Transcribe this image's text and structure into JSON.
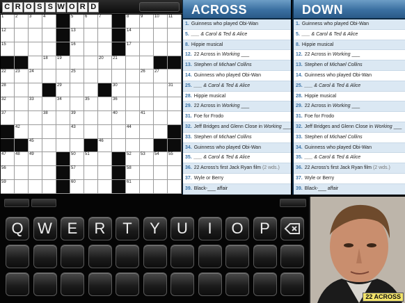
{
  "header": {
    "logo_letters": [
      "C",
      "R",
      "O",
      "S",
      "S",
      "W",
      "O",
      "R",
      "D"
    ]
  },
  "grid": {
    "rows": [
      [
        {
          "n": "1"
        },
        {
          "n": "2"
        },
        {
          "n": "3"
        },
        {
          "n": "4"
        },
        {
          "b": 1
        },
        {
          "n": "5"
        },
        {
          "n": "6"
        },
        {
          "n": "7"
        },
        {
          "b": 1
        },
        {
          "n": "8"
        },
        {
          "n": "9"
        },
        {
          "n": "10"
        },
        {
          "n": "11"
        }
      ],
      [
        {
          "n": "12"
        },
        {},
        {},
        {},
        {
          "b": 1
        },
        {
          "n": "13"
        },
        {},
        {},
        {
          "b": 1
        },
        {
          "n": "14"
        },
        {},
        {},
        {}
      ],
      [
        {
          "n": "15"
        },
        {},
        {},
        {},
        {
          "b": 1
        },
        {
          "n": "16"
        },
        {},
        {},
        {
          "b": 1
        },
        {
          "n": "17"
        },
        {},
        {},
        {}
      ],
      [
        {
          "b": 1
        },
        {
          "b": 1
        },
        {},
        {
          "n": "18"
        },
        {
          "n": "19"
        },
        {},
        {},
        {
          "n": "20"
        },
        {
          "n": "21"
        },
        {},
        {},
        {
          "b": 1
        },
        {
          "b": 1
        }
      ],
      [
        {
          "n": "22"
        },
        {
          "n": "23"
        },
        {
          "n": "24"
        },
        {},
        {},
        {
          "n": "25"
        },
        {},
        {},
        {},
        {},
        {
          "n": "26"
        },
        {
          "n": "27"
        },
        {}
      ],
      [
        {
          "n": "28"
        },
        {},
        {},
        {
          "b": 1
        },
        {
          "n": "29"
        },
        {},
        {},
        {
          "b": 1
        },
        {
          "n": "30"
        },
        {},
        {},
        {},
        {
          "n": "31"
        }
      ],
      [
        {
          "n": "32"
        },
        {},
        {
          "n": "33"
        },
        {},
        {
          "n": "34"
        },
        {},
        {
          "n": "35"
        },
        {},
        {
          "n": "36"
        },
        {},
        {},
        {},
        {}
      ],
      [
        {
          "n": "37"
        },
        {},
        {},
        {
          "n": "38"
        },
        {},
        {
          "n": "39"
        },
        {},
        {},
        {
          "n": "40"
        },
        {},
        {
          "n": "41"
        },
        {},
        {}
      ],
      [
        {
          "b": 1
        },
        {
          "n": "42"
        },
        {},
        {},
        {},
        {
          "n": "43"
        },
        {},
        {},
        {},
        {
          "n": "44"
        },
        {},
        {},
        {
          "b": 1
        }
      ],
      [
        {
          "b": 1
        },
        {
          "b": 1
        },
        {
          "n": "45"
        },
        {},
        {},
        {},
        {
          "b": 1
        },
        {
          "n": "46"
        },
        {},
        {},
        {},
        {
          "b": 1
        },
        {
          "b": 1
        }
      ],
      [
        {
          "n": "47"
        },
        {
          "n": "48"
        },
        {
          "n": "49"
        },
        {},
        {
          "b": 1
        },
        {
          "n": "50"
        },
        {
          "n": "51"
        },
        {},
        {
          "b": 1
        },
        {
          "n": "52"
        },
        {
          "n": "53"
        },
        {
          "n": "54"
        },
        {
          "n": "55"
        }
      ],
      [
        {
          "n": "56"
        },
        {},
        {},
        {},
        {
          "b": 1
        },
        {
          "n": "57"
        },
        {},
        {},
        {
          "b": 1
        },
        {
          "n": "58"
        },
        {},
        {},
        {}
      ],
      [
        {
          "n": "59"
        },
        {},
        {},
        {},
        {
          "b": 1
        },
        {
          "n": "60"
        },
        {},
        {},
        {
          "b": 1
        },
        {
          "n": "61"
        },
        {},
        {},
        {}
      ]
    ]
  },
  "across": {
    "title": "ACROSS",
    "clues": [
      {
        "num": "1.",
        "parts": [
          {
            "t": "Guinness who played Obi-Wan"
          }
        ]
      },
      {
        "num": "5.",
        "parts": [
          {
            "t": "___ & Carol & Ted & Alice",
            "i": 1
          }
        ]
      },
      {
        "num": "8.",
        "parts": [
          {
            "t": "Hippie musical"
          }
        ]
      },
      {
        "num": "12.",
        "parts": [
          {
            "t": "22 Across in "
          },
          {
            "t": "Working",
            "i": 1
          },
          {
            "t": " ___"
          }
        ]
      },
      {
        "num": "13.",
        "parts": [
          {
            "t": "Stephen of "
          },
          {
            "t": "Michael Collins",
            "i": 1
          }
        ]
      },
      {
        "num": "14.",
        "parts": [
          {
            "t": "Guinness who played Obi-Wan"
          }
        ]
      },
      {
        "num": "25.",
        "parts": [
          {
            "t": "___ & Carol & Ted & Alice",
            "i": 1
          }
        ]
      },
      {
        "num": "28.",
        "parts": [
          {
            "t": "Hippie musical"
          }
        ]
      },
      {
        "num": "29.",
        "parts": [
          {
            "t": "22 Across in "
          },
          {
            "t": "Working",
            "i": 1
          },
          {
            "t": " ___"
          }
        ]
      },
      {
        "num": "31.",
        "parts": [
          {
            "t": "Foe for Frodo"
          }
        ]
      },
      {
        "num": "32.",
        "parts": [
          {
            "t": "Jeff Bridges and Glenn Close in "
          },
          {
            "t": "Working",
            "i": 1
          },
          {
            "t": " ___"
          }
        ]
      },
      {
        "num": "33.",
        "parts": [
          {
            "t": "Stephen of "
          },
          {
            "t": "Michael Collins",
            "i": 1
          }
        ]
      },
      {
        "num": "34.",
        "parts": [
          {
            "t": "Guinness who played Obi-Wan"
          }
        ]
      },
      {
        "num": "35.",
        "parts": [
          {
            "t": "___ & Carol & Ted & Alice",
            "i": 1
          }
        ]
      },
      {
        "num": "36.",
        "parts": [
          {
            "t": "22 Across's first Jack Ryan film "
          },
          {
            "t": "(2 wds.)",
            "g": 1
          }
        ]
      },
      {
        "num": "37.",
        "parts": [
          {
            "t": "Wyle or Berry"
          }
        ]
      },
      {
        "num": "39.",
        "parts": [
          {
            "t": "Black-___ affair"
          }
        ]
      }
    ]
  },
  "down": {
    "title": "DOWN",
    "clues": [
      {
        "num": "1.",
        "parts": [
          {
            "t": "Guinness who played Obi-Wan"
          }
        ]
      },
      {
        "num": "5.",
        "parts": [
          {
            "t": "___ & Carol & Ted & Alice",
            "i": 1
          }
        ]
      },
      {
        "num": "8.",
        "parts": [
          {
            "t": "Hippie musical"
          }
        ]
      },
      {
        "num": "12.",
        "parts": [
          {
            "t": "22 Across in "
          },
          {
            "t": "Working",
            "i": 1
          },
          {
            "t": " ___"
          }
        ]
      },
      {
        "num": "13.",
        "parts": [
          {
            "t": "Stephen of "
          },
          {
            "t": "Michael Collins",
            "i": 1
          }
        ]
      },
      {
        "num": "14.",
        "parts": [
          {
            "t": "Guinness who played Obi-Wan"
          }
        ]
      },
      {
        "num": "25.",
        "parts": [
          {
            "t": "___ & Carol & Ted & Alice",
            "i": 1
          }
        ]
      },
      {
        "num": "28.",
        "parts": [
          {
            "t": "Hippie musical"
          }
        ]
      },
      {
        "num": "29.",
        "parts": [
          {
            "t": "22 Across in "
          },
          {
            "t": "Working",
            "i": 1
          },
          {
            "t": " ___"
          }
        ]
      },
      {
        "num": "31.",
        "parts": [
          {
            "t": "Foe for Frodo"
          }
        ]
      },
      {
        "num": "32.",
        "parts": [
          {
            "t": "Jeff Bridges and Glenn Close in "
          },
          {
            "t": "Working",
            "i": 1
          },
          {
            "t": " ___"
          }
        ]
      },
      {
        "num": "33.",
        "parts": [
          {
            "t": "Stephen of "
          },
          {
            "t": "Michael Collins",
            "i": 1
          }
        ]
      },
      {
        "num": "34.",
        "parts": [
          {
            "t": "Guinness who played Obi-Wan"
          }
        ]
      },
      {
        "num": "35.",
        "parts": [
          {
            "t": "___ & Carol & Ted & Alice",
            "i": 1
          }
        ]
      },
      {
        "num": "36.",
        "parts": [
          {
            "t": "22 Across's first Jack Ryan film "
          },
          {
            "t": "(2 wds.)",
            "g": 1
          }
        ]
      },
      {
        "num": "37.",
        "parts": [
          {
            "t": "Wyle or Berry"
          }
        ]
      },
      {
        "num": "39.",
        "parts": [
          {
            "t": "Black-___ affair"
          }
        ]
      }
    ]
  },
  "keyboard": {
    "row1": [
      "Q",
      "W",
      "E",
      "R",
      "T",
      "Y",
      "U",
      "I",
      "O",
      "P"
    ],
    "backspace_icon": "backspace-icon"
  },
  "photo": {
    "caption": "22 ACROSS"
  },
  "colors": {
    "panel_header": "#3a6fa0",
    "clue_number": "#3a73a8",
    "caption_bg": "#f3e46a"
  }
}
